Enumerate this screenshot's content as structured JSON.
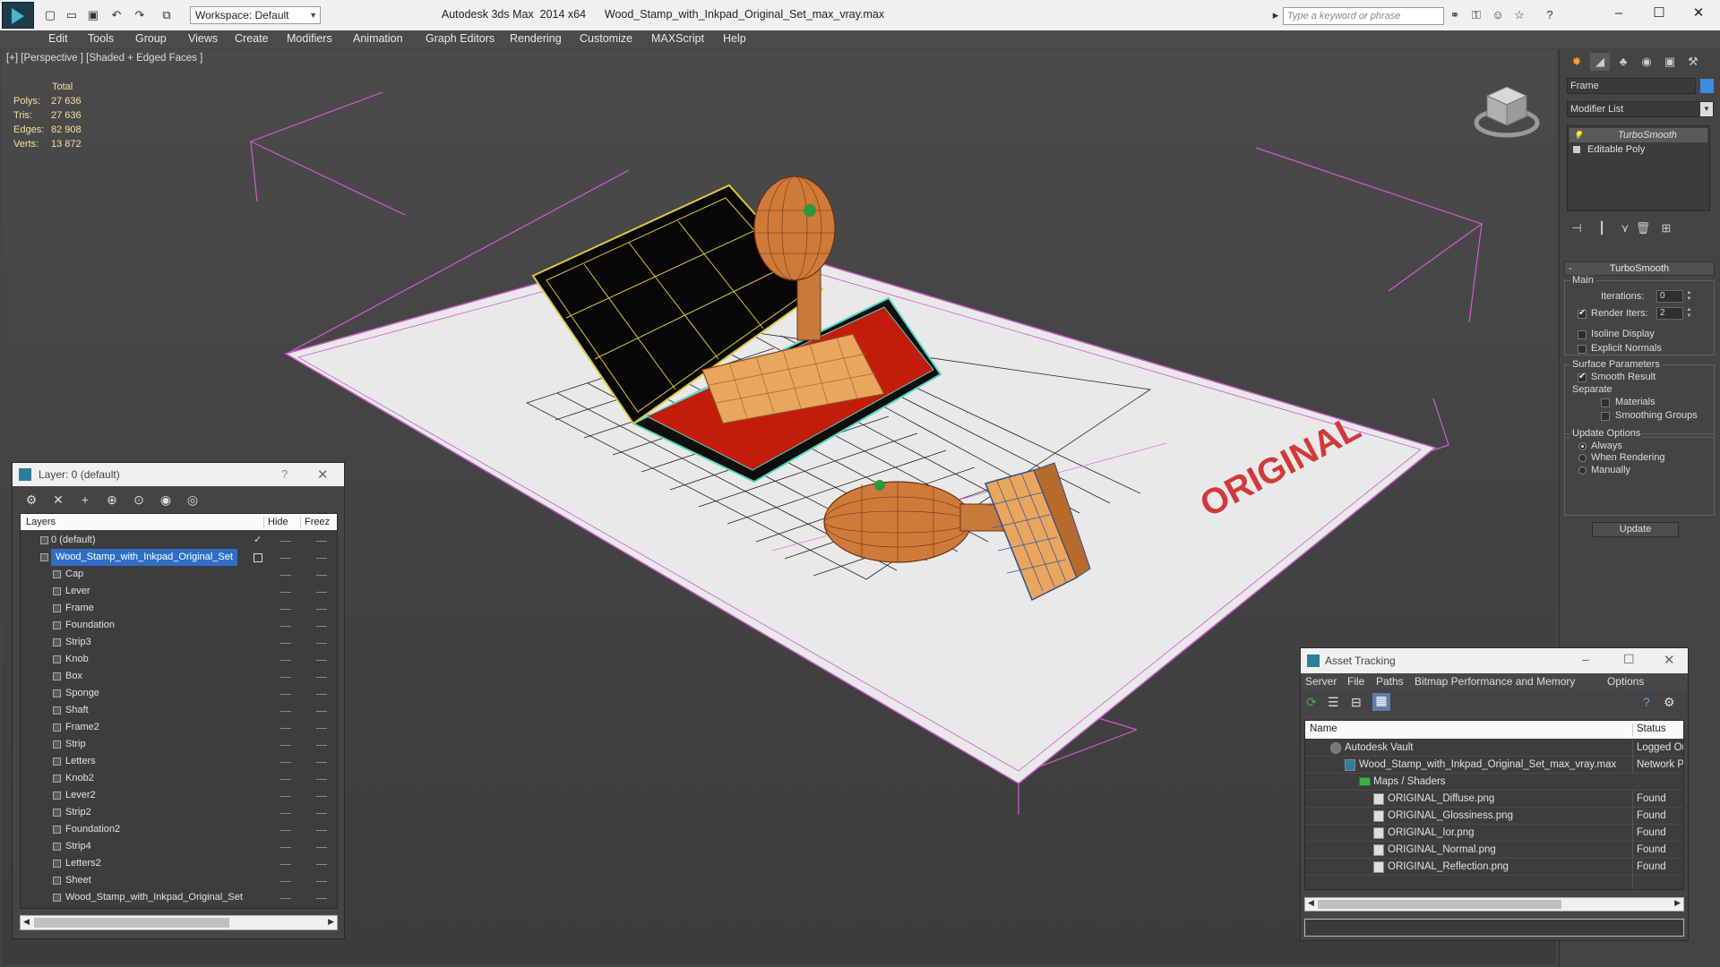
{
  "titlebar": {
    "workspace": "Workspace: Default",
    "title": "Autodesk 3ds Max  2014 x64      Wood_Stamp_with_Inkpad_Original_Set_max_vray.max",
    "search_placeholder": "Type a keyword or phrase"
  },
  "menu": [
    "Edit",
    "Tools",
    "Group",
    "Views",
    "Create",
    "Modifiers",
    "Animation",
    "Graph Editors",
    "Rendering",
    "Customize",
    "MAXScript",
    "Help"
  ],
  "viewport": {
    "label": "[+] [Perspective ] [Shaded + Edged Faces ]",
    "stats": {
      "header": "Total",
      "rows": [
        {
          "label": "Polys:",
          "value": "27 636"
        },
        {
          "label": "Tris:",
          "value": "27 636"
        },
        {
          "label": "Edges:",
          "value": "82 908"
        },
        {
          "label": "Verts:",
          "value": "13 872"
        }
      ]
    },
    "stamp_text": "ORIGINAL"
  },
  "command_panel": {
    "object_name": "Frame",
    "object_color": "#3a8de0",
    "modifier_list": "Modifier List",
    "stack": [
      "TurboSmooth",
      "Editable Poly"
    ],
    "rollout_title": "TurboSmooth",
    "main_group": "Main",
    "iterations_label": "Iterations:",
    "iterations_value": "0",
    "render_iters_label": "Render Iters:",
    "render_iters_value": "2",
    "render_iters_checked": true,
    "isoline_label": "Isoline Display",
    "explicit_normals_label": "Explicit Normals",
    "surface_group": "Surface Parameters",
    "smooth_result_label": "Smooth Result",
    "separate_label": "Separate",
    "materials_label": "Materials",
    "smoothing_groups_label": "Smoothing Groups",
    "update_group": "Update Options",
    "update_options": [
      "Always",
      "When Rendering",
      "Manually"
    ],
    "update_selected": "Always",
    "update_button": "Update"
  },
  "layers": {
    "title": "Layer: 0 (default)",
    "help": "?",
    "columns": {
      "name": "Layers",
      "hide": "Hide",
      "freeze": "Freez"
    },
    "rows": [
      {
        "name": "0 (default)",
        "level": 0,
        "selected": false
      },
      {
        "name": "Wood_Stamp_with_Inkpad_Original_Set",
        "level": 0,
        "selected": true
      },
      {
        "name": "Cap",
        "level": 1
      },
      {
        "name": "Lever",
        "level": 1
      },
      {
        "name": "Frame",
        "level": 1
      },
      {
        "name": "Foundation",
        "level": 1
      },
      {
        "name": "Strip3",
        "level": 1
      },
      {
        "name": "Knob",
        "level": 1
      },
      {
        "name": "Box",
        "level": 1
      },
      {
        "name": "Sponge",
        "level": 1
      },
      {
        "name": "Shaft",
        "level": 1
      },
      {
        "name": "Frame2",
        "level": 1
      },
      {
        "name": "Strip",
        "level": 1
      },
      {
        "name": "Letters",
        "level": 1
      },
      {
        "name": "Knob2",
        "level": 1
      },
      {
        "name": "Lever2",
        "level": 1
      },
      {
        "name": "Strip2",
        "level": 1
      },
      {
        "name": "Foundation2",
        "level": 1
      },
      {
        "name": "Strip4",
        "level": 1
      },
      {
        "name": "Letters2",
        "level": 1
      },
      {
        "name": "Sheet",
        "level": 1
      },
      {
        "name": "Wood_Stamp_with_Inkpad_Original_Set",
        "level": 1
      }
    ]
  },
  "asset_tracking": {
    "title": "Asset Tracking",
    "menu": [
      "Server",
      "File",
      "Paths",
      "Bitmap Performance and Memory",
      "Options"
    ],
    "columns": {
      "name": "Name",
      "status": "Status"
    },
    "rows": [
      {
        "name": "Autodesk Vault",
        "status": "Logged Ou",
        "level": 0,
        "icon": "vault-icon"
      },
      {
        "name": "Wood_Stamp_with_Inkpad_Original_Set_max_vray.max",
        "status": "Network Pa",
        "level": 1,
        "icon": "max-file-icon"
      },
      {
        "name": "Maps / Shaders",
        "status": "",
        "level": 2,
        "icon": "folder-icon"
      },
      {
        "name": "ORIGINAL_Diffuse.png",
        "status": "Found",
        "level": 3,
        "icon": "image-file-icon"
      },
      {
        "name": "ORIGINAL_Glossiness.png",
        "status": "Found",
        "level": 3,
        "icon": "image-file-icon"
      },
      {
        "name": "ORIGINAL_Ior.png",
        "status": "Found",
        "level": 3,
        "icon": "image-file-icon"
      },
      {
        "name": "ORIGINAL_Normal.png",
        "status": "Found",
        "level": 3,
        "icon": "image-file-icon"
      },
      {
        "name": "ORIGINAL_Reflection.png",
        "status": "Found",
        "level": 3,
        "icon": "image-file-icon"
      }
    ]
  }
}
